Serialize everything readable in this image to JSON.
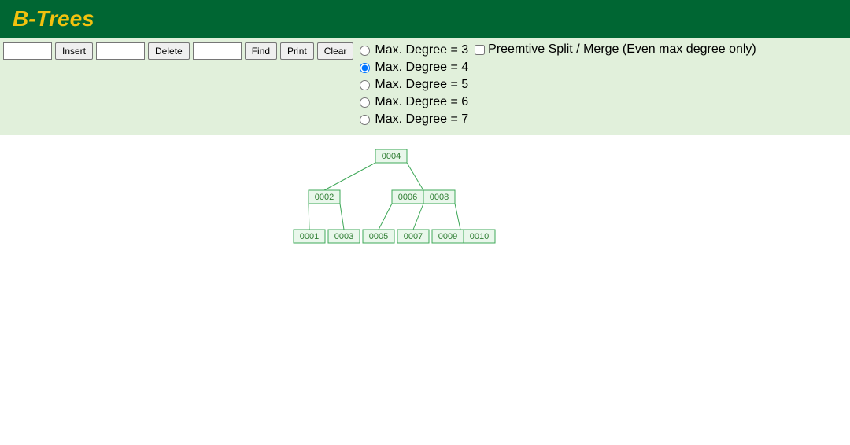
{
  "header": {
    "title": "B-Trees"
  },
  "controls": {
    "insert_label": "Insert",
    "delete_label": "Delete",
    "find_label": "Find",
    "print_label": "Print",
    "clear_label": "Clear",
    "insert_value": "",
    "delete_value": "",
    "find_value": ""
  },
  "degree": {
    "options": [
      {
        "label": "Max. Degree = 3",
        "value": 3,
        "selected": false
      },
      {
        "label": "Max. Degree = 4",
        "value": 4,
        "selected": true
      },
      {
        "label": "Max. Degree = 5",
        "value": 5,
        "selected": false
      },
      {
        "label": "Max. Degree = 6",
        "value": 6,
        "selected": false
      },
      {
        "label": "Max. Degree = 7",
        "value": 7,
        "selected": false
      }
    ]
  },
  "preemptive": {
    "label": "Preemtive Split / Merge (Even max degree only)",
    "checked": false
  },
  "tree": {
    "root": {
      "keys": [
        "0004"
      ]
    },
    "level1": [
      {
        "keys": [
          "0002"
        ]
      },
      {
        "keys": [
          "0006",
          "0008"
        ]
      }
    ],
    "leaves": [
      {
        "keys": [
          "0001"
        ]
      },
      {
        "keys": [
          "0003"
        ]
      },
      {
        "keys": [
          "0005"
        ]
      },
      {
        "keys": [
          "0007"
        ]
      },
      {
        "keys": [
          "0009",
          "0010"
        ]
      }
    ]
  }
}
